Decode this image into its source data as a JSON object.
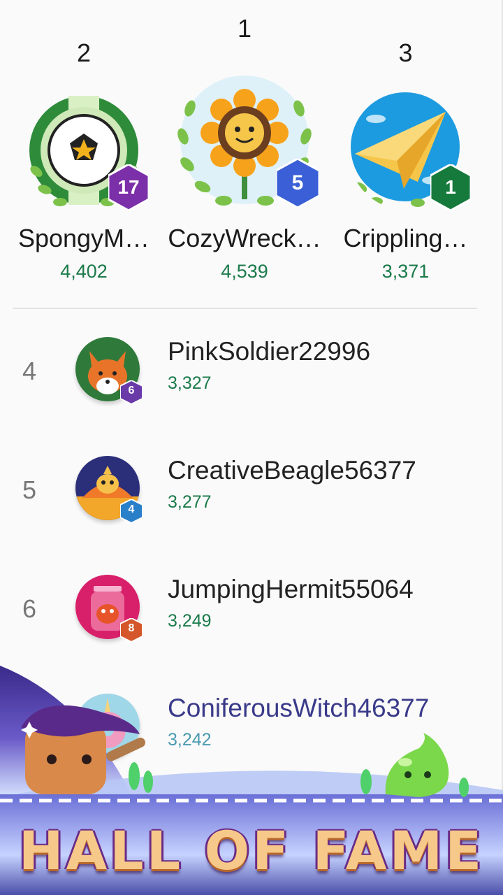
{
  "podium": [
    {
      "rank": "1",
      "name": "CozyWreck…",
      "score": "4,539",
      "level": "5",
      "badge_color": "#3a5fd6",
      "avatar_icon": "sunflower-icon"
    },
    {
      "rank": "2",
      "name": "SpongyM…",
      "score": "4,402",
      "level": "17",
      "badge_color": "#7b2fa8",
      "avatar_icon": "soccer-ball-icon"
    },
    {
      "rank": "3",
      "name": "Crippling…",
      "score": "3,371",
      "level": "1",
      "badge_color": "#167a3c",
      "avatar_icon": "paper-plane-icon"
    }
  ],
  "list": [
    {
      "rank": "4",
      "name": "PinkSoldier22996",
      "score": "3,327",
      "level": "6",
      "badge_color": "#6a3aa8",
      "avatar_icon": "fox-icon"
    },
    {
      "rank": "5",
      "name": "CreativeBeagle56377",
      "score": "3,277",
      "level": "4",
      "badge_color": "#2a7fc9",
      "avatar_icon": "phoenix-icon"
    },
    {
      "rank": "6",
      "name": "JumpingHermit55064",
      "score": "3,249",
      "level": "8",
      "badge_color": "#d4562a",
      "avatar_icon": "jar-monster-icon"
    },
    {
      "rank": "",
      "name": "ConiferousWitch46377",
      "score": "3,242",
      "level": "",
      "badge_color": "#5a7ad0",
      "avatar_icon": "unicorn-donut-icon"
    }
  ],
  "banner": {
    "title": "HALL OF FAME"
  },
  "colors": {
    "score_green": "#1b7a4a",
    "banner_purple": "#5b3fa8"
  }
}
